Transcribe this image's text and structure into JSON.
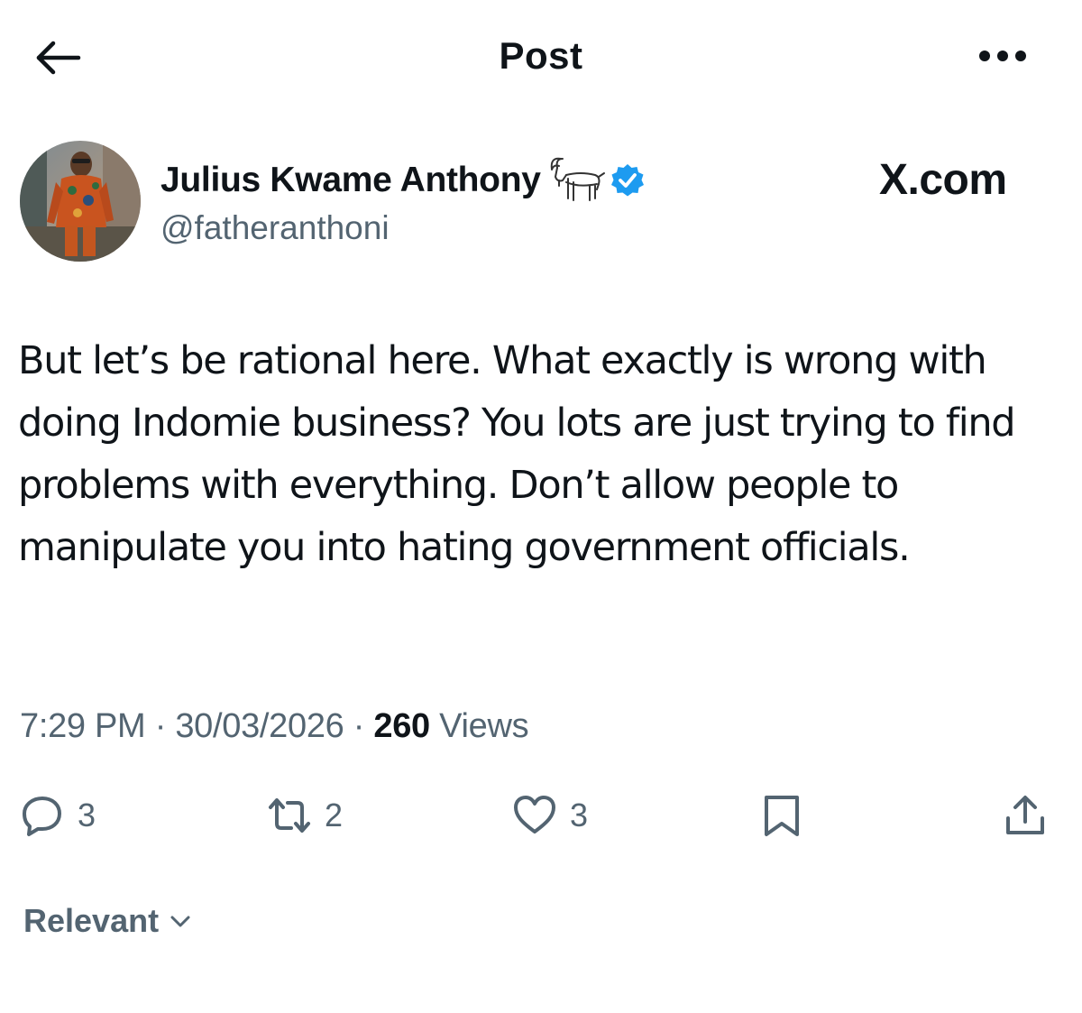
{
  "header": {
    "title": "Post",
    "back_icon": "arrow-left-icon",
    "more_icon": "more-horizontal-icon"
  },
  "author": {
    "display_name": "Julius Kwame Anthony",
    "handle": "@fatheranthoni",
    "emoji_icon": "goat-icon",
    "verified_icon": "verified-badge-icon",
    "verified_color": "#1d9bf0"
  },
  "watermark": "X.com",
  "post": {
    "text": "But let’s be rational here. What exactly is wrong with doing Indomie business? You lots are just trying to find problems with everything. Don’t allow people to manipulate you into hating government officials."
  },
  "meta": {
    "time": "7:29 PM",
    "separator": "·",
    "date": "30/03/2026",
    "views_count": "260",
    "views_label": "Views"
  },
  "actions": {
    "reply_count": "3",
    "repost_count": "2",
    "like_count": "3",
    "reply_icon": "reply-icon",
    "repost_icon": "repost-icon",
    "like_icon": "heart-icon",
    "bookmark_icon": "bookmark-icon",
    "share_icon": "share-icon"
  },
  "sort": {
    "label": "Relevant",
    "icon": "chevron-down-icon"
  },
  "colors": {
    "text_primary": "#0f1419",
    "text_secondary": "#536471",
    "background": "#ffffff"
  }
}
